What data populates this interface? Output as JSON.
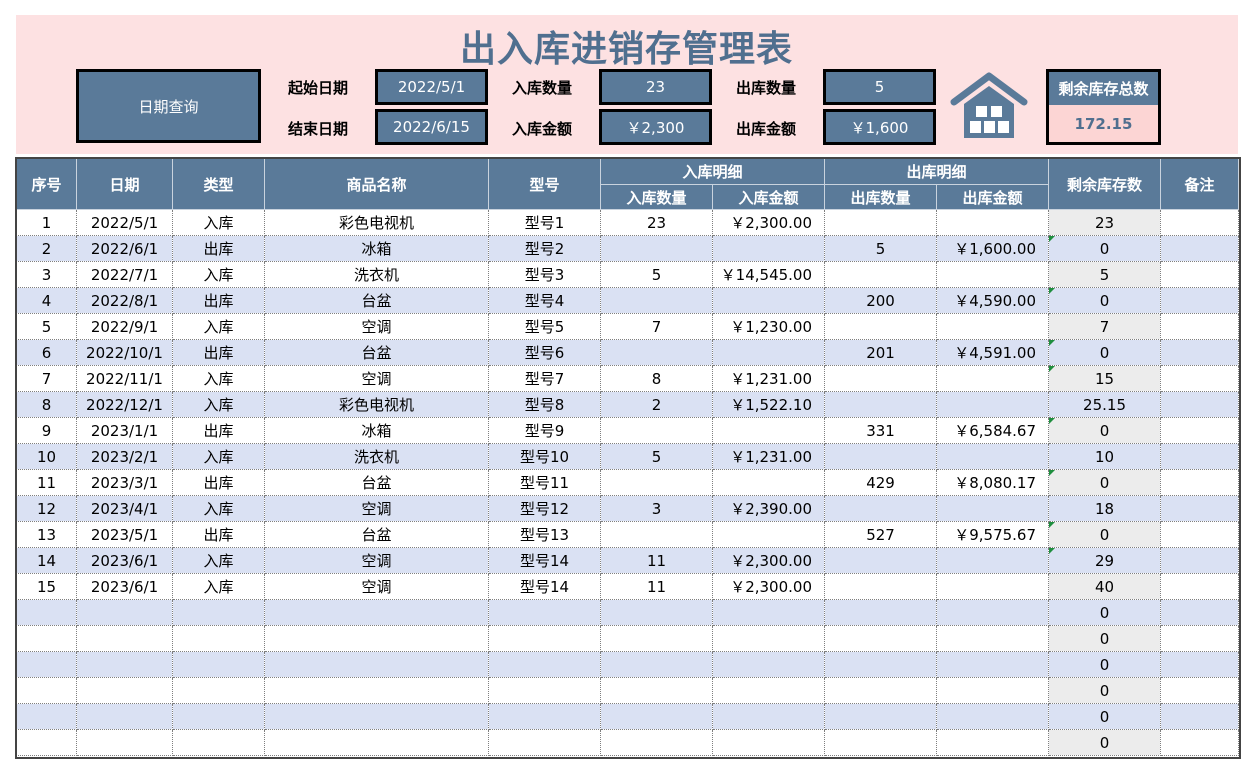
{
  "title": "出入库进销存管理表",
  "header": {
    "query_button": "日期查询",
    "start_label": "起始日期",
    "start_value": "2022/5/1",
    "end_label": "结束日期",
    "end_value": "2022/6/15",
    "in_qty_label": "入库数量",
    "in_qty_value": "23",
    "in_amt_label": "入库金额",
    "in_amt_value": "￥2,300",
    "out_qty_label": "出库数量",
    "out_qty_value": "5",
    "out_amt_label": "出库金额",
    "out_amt_value": "￥1,600",
    "total_label": "剩余库存总数",
    "total_value": "172.15"
  },
  "colors": {
    "accent": "#5a7a99",
    "title": "#506f8f",
    "band": "#fde1e2",
    "stripe": "#dae1f3"
  },
  "table": {
    "headers": {
      "seq": "序号",
      "date": "日期",
      "type": "类型",
      "name": "商品名称",
      "model": "型号",
      "in_group": "入库明细",
      "out_group": "出库明细",
      "in_qty": "入库数量",
      "in_amt": "入库金额",
      "out_qty": "出库数量",
      "out_amt": "出库金额",
      "remaining": "剩余库存数",
      "note": "备注"
    },
    "rows": [
      {
        "seq": "1",
        "date": "2022/5/1",
        "type": "入库",
        "name": "彩色电视机",
        "model": "型号1",
        "in_qty": "23",
        "in_amt": "￥2,300.00",
        "out_qty": "",
        "out_amt": "",
        "remaining": "23",
        "note": ""
      },
      {
        "seq": "2",
        "date": "2022/6/1",
        "type": "出库",
        "name": "冰箱",
        "model": "型号2",
        "in_qty": "",
        "in_amt": "",
        "out_qty": "5",
        "out_amt": "￥1,600.00",
        "remaining": "0",
        "note": ""
      },
      {
        "seq": "3",
        "date": "2022/7/1",
        "type": "入库",
        "name": "洗衣机",
        "model": "型号3",
        "in_qty": "5",
        "in_amt": "￥14,545.00",
        "out_qty": "",
        "out_amt": "",
        "remaining": "5",
        "note": ""
      },
      {
        "seq": "4",
        "date": "2022/8/1",
        "type": "出库",
        "name": "台盆",
        "model": "型号4",
        "in_qty": "",
        "in_amt": "",
        "out_qty": "200",
        "out_amt": "￥4,590.00",
        "remaining": "0",
        "note": ""
      },
      {
        "seq": "5",
        "date": "2022/9/1",
        "type": "入库",
        "name": "空调",
        "model": "型号5",
        "in_qty": "7",
        "in_amt": "￥1,230.00",
        "out_qty": "",
        "out_amt": "",
        "remaining": "7",
        "note": ""
      },
      {
        "seq": "6",
        "date": "2022/10/1",
        "type": "出库",
        "name": "台盆",
        "model": "型号6",
        "in_qty": "",
        "in_amt": "",
        "out_qty": "201",
        "out_amt": "￥4,591.00",
        "remaining": "0",
        "note": ""
      },
      {
        "seq": "7",
        "date": "2022/11/1",
        "type": "入库",
        "name": "空调",
        "model": "型号7",
        "in_qty": "8",
        "in_amt": "￥1,231.00",
        "out_qty": "",
        "out_amt": "",
        "remaining": "15",
        "note": ""
      },
      {
        "seq": "8",
        "date": "2022/12/1",
        "type": "入库",
        "name": "彩色电视机",
        "model": "型号8",
        "in_qty": "2",
        "in_amt": "￥1,522.10",
        "out_qty": "",
        "out_amt": "",
        "remaining": "25.15",
        "note": ""
      },
      {
        "seq": "9",
        "date": "2023/1/1",
        "type": "出库",
        "name": "冰箱",
        "model": "型号9",
        "in_qty": "",
        "in_amt": "",
        "out_qty": "331",
        "out_amt": "￥6,584.67",
        "remaining": "0",
        "note": ""
      },
      {
        "seq": "10",
        "date": "2023/2/1",
        "type": "入库",
        "name": "洗衣机",
        "model": "型号10",
        "in_qty": "5",
        "in_amt": "￥1,231.00",
        "out_qty": "",
        "out_amt": "",
        "remaining": "10",
        "note": ""
      },
      {
        "seq": "11",
        "date": "2023/3/1",
        "type": "出库",
        "name": "台盆",
        "model": "型号11",
        "in_qty": "",
        "in_amt": "",
        "out_qty": "429",
        "out_amt": "￥8,080.17",
        "remaining": "0",
        "note": ""
      },
      {
        "seq": "12",
        "date": "2023/4/1",
        "type": "入库",
        "name": "空调",
        "model": "型号12",
        "in_qty": "3",
        "in_amt": "￥2,390.00",
        "out_qty": "",
        "out_amt": "",
        "remaining": "18",
        "note": ""
      },
      {
        "seq": "13",
        "date": "2023/5/1",
        "type": "出库",
        "name": "台盆",
        "model": "型号13",
        "in_qty": "",
        "in_amt": "",
        "out_qty": "527",
        "out_amt": "￥9,575.67",
        "remaining": "0",
        "note": ""
      },
      {
        "seq": "14",
        "date": "2023/6/1",
        "type": "入库",
        "name": "空调",
        "model": "型号14",
        "in_qty": "11",
        "in_amt": "￥2,300.00",
        "out_qty": "",
        "out_amt": "",
        "remaining": "29",
        "note": ""
      },
      {
        "seq": "15",
        "date": "2023/6/1",
        "type": "入库",
        "name": "空调",
        "model": "型号14",
        "in_qty": "11",
        "in_amt": "￥2,300.00",
        "out_qty": "",
        "out_amt": "",
        "remaining": "40",
        "note": ""
      },
      {
        "seq": "",
        "date": "",
        "type": "",
        "name": "",
        "model": "",
        "in_qty": "",
        "in_amt": "",
        "out_qty": "",
        "out_amt": "",
        "remaining": "0",
        "note": ""
      },
      {
        "seq": "",
        "date": "",
        "type": "",
        "name": "",
        "model": "",
        "in_qty": "",
        "in_amt": "",
        "out_qty": "",
        "out_amt": "",
        "remaining": "0",
        "note": ""
      },
      {
        "seq": "",
        "date": "",
        "type": "",
        "name": "",
        "model": "",
        "in_qty": "",
        "in_amt": "",
        "out_qty": "",
        "out_amt": "",
        "remaining": "0",
        "note": ""
      },
      {
        "seq": "",
        "date": "",
        "type": "",
        "name": "",
        "model": "",
        "in_qty": "",
        "in_amt": "",
        "out_qty": "",
        "out_amt": "",
        "remaining": "0",
        "note": ""
      },
      {
        "seq": "",
        "date": "",
        "type": "",
        "name": "",
        "model": "",
        "in_qty": "",
        "in_amt": "",
        "out_qty": "",
        "out_amt": "",
        "remaining": "0",
        "note": ""
      },
      {
        "seq": "",
        "date": "",
        "type": "",
        "name": "",
        "model": "",
        "in_qty": "",
        "in_amt": "",
        "out_qty": "",
        "out_amt": "",
        "remaining": "0",
        "note": ""
      }
    ]
  }
}
